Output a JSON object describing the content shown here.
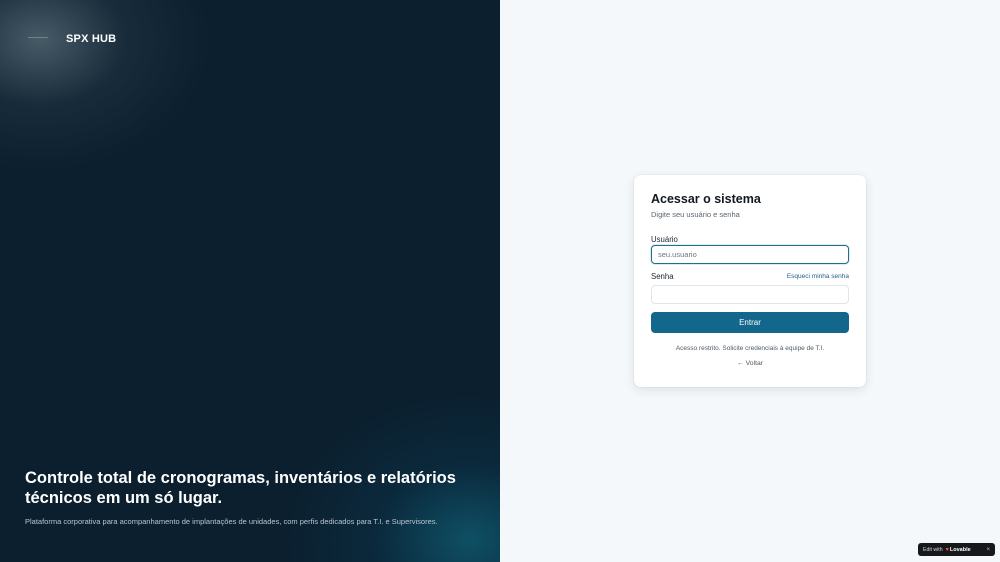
{
  "brand": {
    "name": "SPX HUB"
  },
  "hero": {
    "headline": "Controle total de cronogramas, inventários e relatórios técnicos em um só lugar.",
    "description": "Plataforma corporativa para acompanhamento de implantações de unidades, com perfis dedicados para T.I. e Supervisores."
  },
  "login": {
    "title": "Acessar o sistema",
    "subtitle": "Digite seu usuário e senha",
    "username_label": "Usuário",
    "username_placeholder": "seu.usuario",
    "username_value": "",
    "password_label": "Senha",
    "password_value": "",
    "forgot_label": "Esqueci minha senha",
    "submit_label": "Entrar",
    "restricted_note": "Acesso restrito. Solicite credenciais à equipe de T.I.",
    "back_label": "← Voltar"
  },
  "badge": {
    "edit_label": "Edit with",
    "heart_icon": "♥",
    "brand_label": "Lovable",
    "close_label": "×"
  },
  "colors": {
    "left_panel_bg": "#0b1f2e",
    "right_panel_bg": "#f4f8fa",
    "primary_button": "#14678c",
    "focus_border": "#1f6f8e",
    "link": "#1e5f8a"
  }
}
